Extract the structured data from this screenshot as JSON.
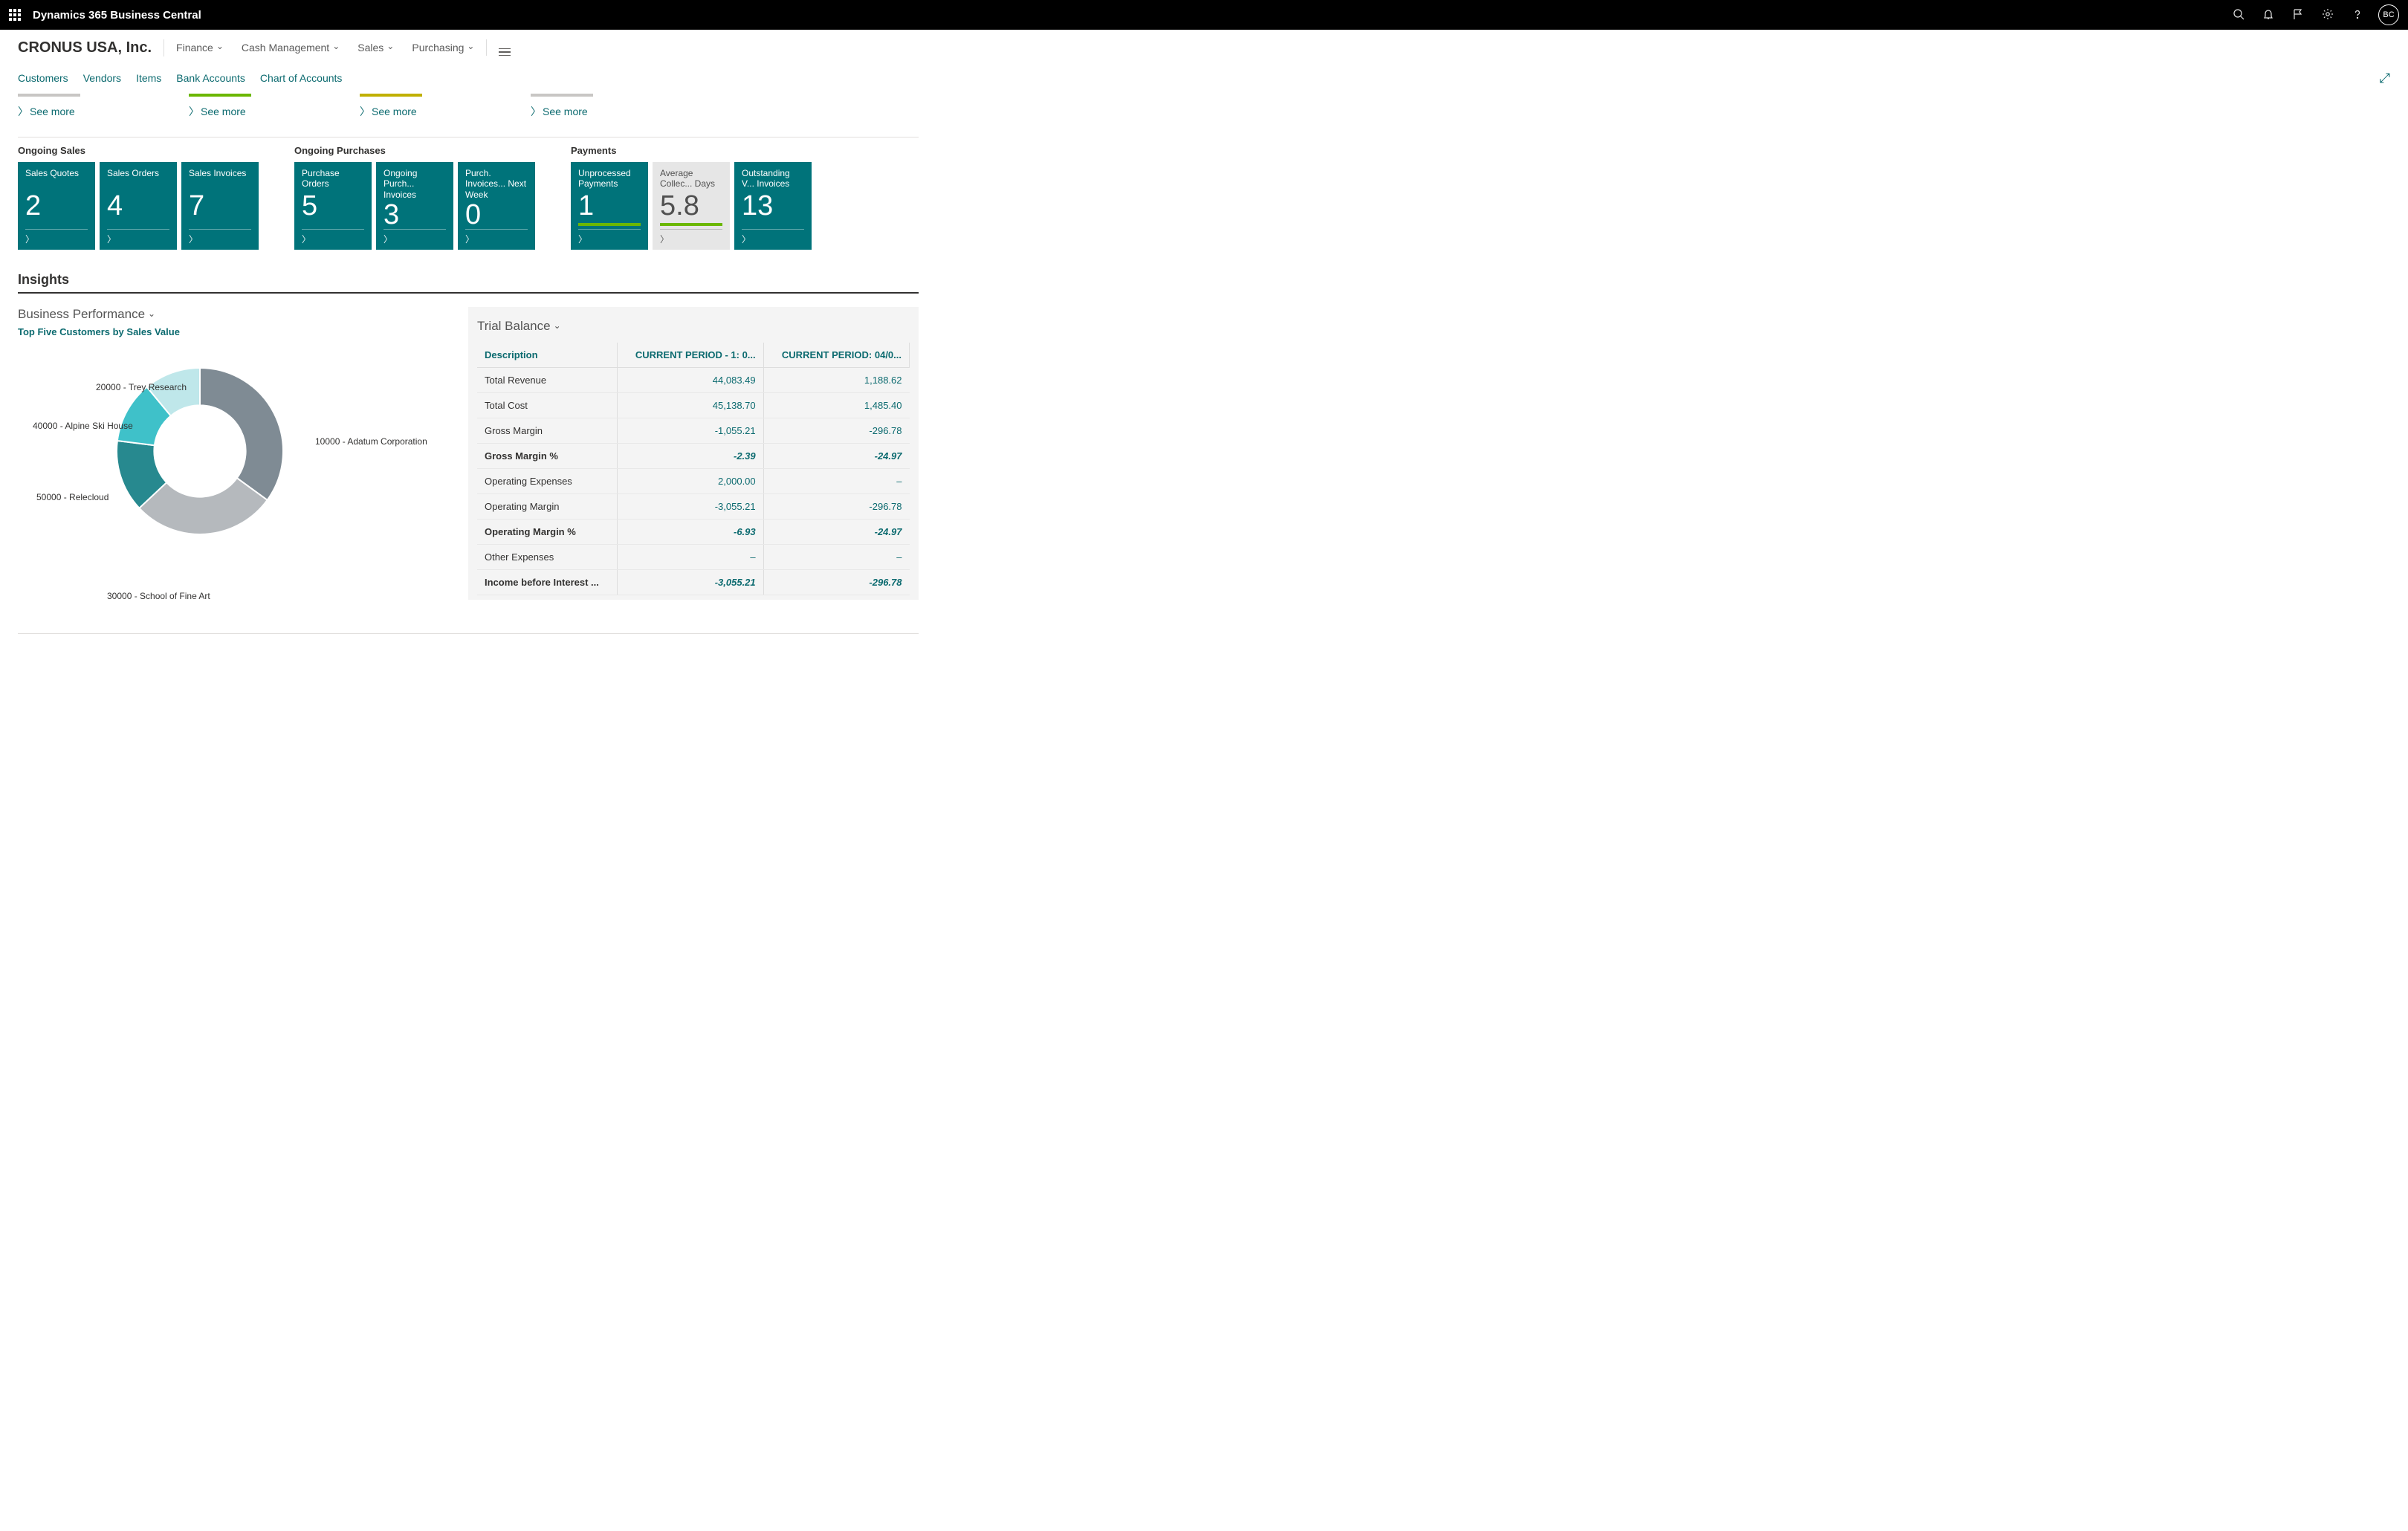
{
  "topbar": {
    "app_title": "Dynamics 365 Business Central",
    "avatar_initials": "BC"
  },
  "company": "CRONUS USA, Inc.",
  "main_menu": [
    "Finance",
    "Cash Management",
    "Sales",
    "Purchasing"
  ],
  "sub_nav": [
    "Customers",
    "Vendors",
    "Items",
    "Bank Accounts",
    "Chart of Accounts"
  ],
  "see_more_label": "See more",
  "tile_groups": [
    {
      "title": "Ongoing Sales",
      "tiles": [
        {
          "label": "Sales Quotes",
          "value": "2",
          "style": "teal"
        },
        {
          "label": "Sales Orders",
          "value": "4",
          "style": "teal"
        },
        {
          "label": "Sales Invoices",
          "value": "7",
          "style": "teal"
        }
      ]
    },
    {
      "title": "Ongoing Purchases",
      "tiles": [
        {
          "label": "Purchase Orders",
          "value": "5",
          "style": "teal"
        },
        {
          "label": "Ongoing Purch... Invoices",
          "value": "3",
          "style": "teal"
        },
        {
          "label": "Purch. Invoices... Next Week",
          "value": "0",
          "style": "teal"
        }
      ]
    },
    {
      "title": "Payments",
      "tiles": [
        {
          "label": "Unprocessed Payments",
          "value": "1",
          "style": "teal",
          "accent": "green"
        },
        {
          "label": "Average Collec... Days",
          "value": "5.8",
          "style": "gray",
          "accent": "green"
        },
        {
          "label": "Outstanding V... Invoices",
          "value": "13",
          "style": "teal"
        }
      ]
    }
  ],
  "insights_title": "Insights",
  "biz_perf": {
    "title": "Business Performance",
    "subtitle": "Top Five Customers by Sales Value"
  },
  "chart_data": {
    "type": "pie",
    "title": "Top Five Customers by Sales Value",
    "series": [
      {
        "name": "10000 - Adatum Corporation",
        "value": 35,
        "color": "#7f8b94"
      },
      {
        "name": "30000 - School of Fine Art",
        "value": 28,
        "color": "#b5b9bd"
      },
      {
        "name": "50000 - Relecloud",
        "value": 14,
        "color": "#27898f"
      },
      {
        "name": "40000 - Alpine Ski House",
        "value": 12,
        "color": "#3fc1c9"
      },
      {
        "name": "20000 - Trey Research",
        "value": 11,
        "color": "#bfe7ea"
      }
    ],
    "donut_inner_ratio": 0.55
  },
  "trial_balance": {
    "title": "Trial Balance",
    "headers": [
      "Description",
      "CURRENT PERIOD - 1: 0...",
      "CURRENT PERIOD: 04/0..."
    ],
    "rows": [
      {
        "desc": "Total Revenue",
        "c1": "44,083.49",
        "c2": "1,188.62"
      },
      {
        "desc": "Total Cost",
        "c1": "45,138.70",
        "c2": "1,485.40"
      },
      {
        "desc": "Gross Margin",
        "c1": "-1,055.21",
        "c2": "-296.78"
      },
      {
        "desc": "Gross Margin %",
        "c1": "-2.39",
        "c2": "-24.97",
        "bold": true
      },
      {
        "desc": "Operating Expenses",
        "c1": "2,000.00",
        "c2": "–"
      },
      {
        "desc": "Operating Margin",
        "c1": "-3,055.21",
        "c2": "-296.78"
      },
      {
        "desc": "Operating Margin %",
        "c1": "-6.93",
        "c2": "-24.97",
        "bold": true
      },
      {
        "desc": "Other Expenses",
        "c1": "–",
        "c2": "–"
      },
      {
        "desc": "Income before Interest ...",
        "c1": "-3,055.21",
        "c2": "-296.78",
        "bold": true
      }
    ]
  }
}
